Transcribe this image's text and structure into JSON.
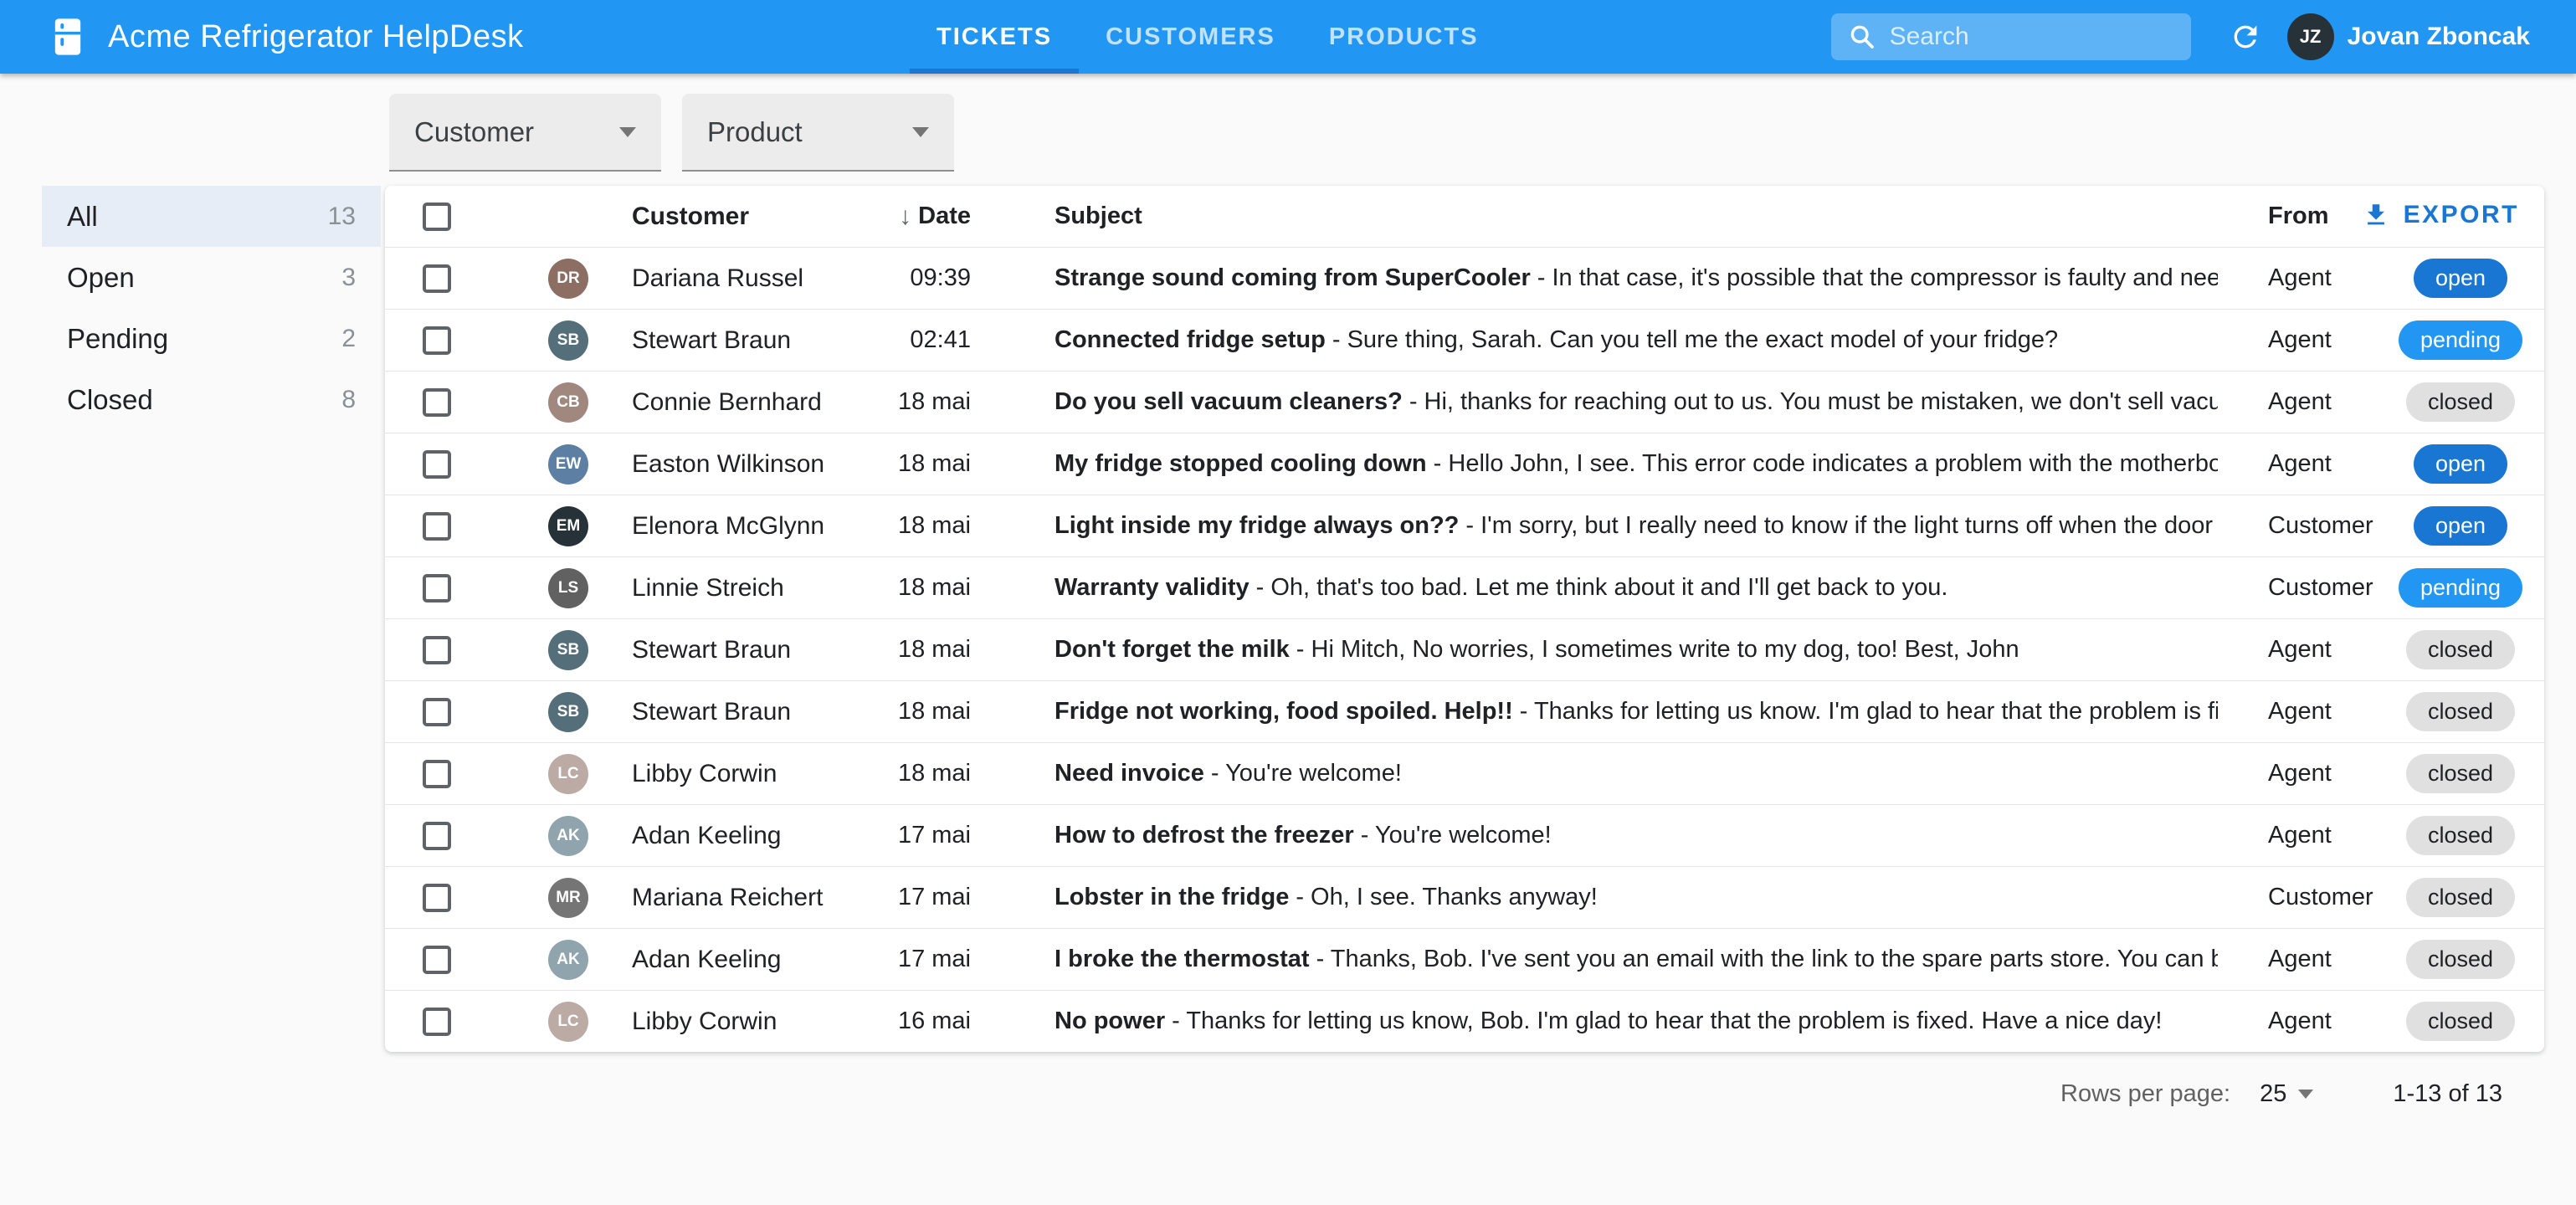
{
  "app": {
    "title": "Acme Refrigerator HelpDesk",
    "user_name": "Jovan Zboncak",
    "user_initials": "JZ"
  },
  "nav": {
    "tickets": "TICKETS",
    "customers": "CUSTOMERS",
    "products": "PRODUCTS"
  },
  "search": {
    "placeholder": "Search"
  },
  "filters": {
    "customer": "Customer",
    "product": "Product"
  },
  "toolbar": {
    "export_label": "EXPORT"
  },
  "sidebar": {
    "items": [
      {
        "label": "All",
        "count": "13",
        "selected": true
      },
      {
        "label": "Open",
        "count": "3",
        "selected": false
      },
      {
        "label": "Pending",
        "count": "2",
        "selected": false
      },
      {
        "label": "Closed",
        "count": "8",
        "selected": false
      }
    ]
  },
  "table": {
    "headers": {
      "customer": "Customer",
      "date": "Date",
      "subject": "Subject",
      "from": "From"
    },
    "sort_icon": "↓",
    "rows": [
      {
        "customer": "Dariana Russel",
        "initials": "DR",
        "avatar_color": "#8d6e63",
        "date": "09:39",
        "subject": "Strange sound coming from SuperCooler",
        "preview": "- In that case, it's possible that the compressor is faulty and needs …",
        "from": "Agent",
        "status": "open"
      },
      {
        "customer": "Stewart Braun",
        "initials": "SB",
        "avatar_color": "#546e7a",
        "date": "02:41",
        "subject": "Connected fridge setup",
        "preview": "- Sure thing, Sarah. Can you tell me the exact model of your fridge?",
        "from": "Agent",
        "status": "pending"
      },
      {
        "customer": "Connie Bernhard",
        "initials": "CB",
        "avatar_color": "#a1887f",
        "date": "18 mai",
        "subject": "Do you sell vacuum cleaners?",
        "preview": "- Hi, thanks for reaching out to us. You must be mistaken, we don't sell vacuu…",
        "from": "Agent",
        "status": "closed"
      },
      {
        "customer": "Easton Wilkinson",
        "initials": "EW",
        "avatar_color": "#5c7fa3",
        "date": "18 mai",
        "subject": "My fridge stopped cooling down",
        "preview": "- Hello John, I see. This error code indicates a problem with the motherboar…",
        "from": "Agent",
        "status": "open"
      },
      {
        "customer": "Elenora McGlynn",
        "initials": "EM",
        "avatar_color": "#263238",
        "date": "18 mai",
        "subject": "Light inside my fridge always on??",
        "preview": "- I'm sorry, but I really need to know if the light turns off when the door is …",
        "from": "Customer",
        "status": "open"
      },
      {
        "customer": "Linnie Streich",
        "initials": "LS",
        "avatar_color": "#616161",
        "date": "18 mai",
        "subject": "Warranty validity",
        "preview": "- Oh, that's too bad. Let me think about it and I'll get back to you.",
        "from": "Customer",
        "status": "pending"
      },
      {
        "customer": "Stewart Braun",
        "initials": "SB",
        "avatar_color": "#546e7a",
        "date": "18 mai",
        "subject": "Don't forget the milk",
        "preview": "- Hi Mitch, No worries, I sometimes write to my dog, too! Best, John",
        "from": "Agent",
        "status": "closed"
      },
      {
        "customer": "Stewart Braun",
        "initials": "SB",
        "avatar_color": "#546e7a",
        "date": "18 mai",
        "subject": "Fridge not working, food spoiled. Help!!",
        "preview": "- Thanks for letting us know. I'm glad to hear that the problem is fixe…",
        "from": "Agent",
        "status": "closed"
      },
      {
        "customer": "Libby Corwin",
        "initials": "LC",
        "avatar_color": "#bcaaa4",
        "date": "18 mai",
        "subject": "Need invoice",
        "preview": "- You're welcome!",
        "from": "Agent",
        "status": "closed"
      },
      {
        "customer": "Adan Keeling",
        "initials": "AK",
        "avatar_color": "#90a4ae",
        "date": "17 mai",
        "subject": "How to defrost the freezer",
        "preview": "- You're welcome!",
        "from": "Agent",
        "status": "closed"
      },
      {
        "customer": "Mariana Reichert",
        "initials": "MR",
        "avatar_color": "#757575",
        "date": "17 mai",
        "subject": "Lobster in the fridge",
        "preview": "- Oh, I see. Thanks anyway!",
        "from": "Customer",
        "status": "closed"
      },
      {
        "customer": "Adan Keeling",
        "initials": "AK",
        "avatar_color": "#90a4ae",
        "date": "17 mai",
        "subject": "I broke the thermostat",
        "preview": "- Thanks, Bob. I've sent you an email with the link to the spare parts store. You can bu…",
        "from": "Agent",
        "status": "closed"
      },
      {
        "customer": "Libby Corwin",
        "initials": "LC",
        "avatar_color": "#bcaaa4",
        "date": "16 mai",
        "subject": "No power",
        "preview": "- Thanks for letting us know, Bob. I'm glad to hear that the problem is fixed. Have a nice day!",
        "from": "Agent",
        "status": "closed"
      }
    ]
  },
  "pagination": {
    "label": "Rows per page:",
    "value": "25",
    "range": "1-13 of 13"
  },
  "colors": {
    "appbar": "#2196f3",
    "tab_indicator": "#1976d2",
    "accent": "#1976d2",
    "status_open": "#1976d2",
    "status_pending": "#2196f3",
    "status_closed_bg": "#e0e0e0",
    "sidebar_selected_bg": "#e7edf7"
  }
}
